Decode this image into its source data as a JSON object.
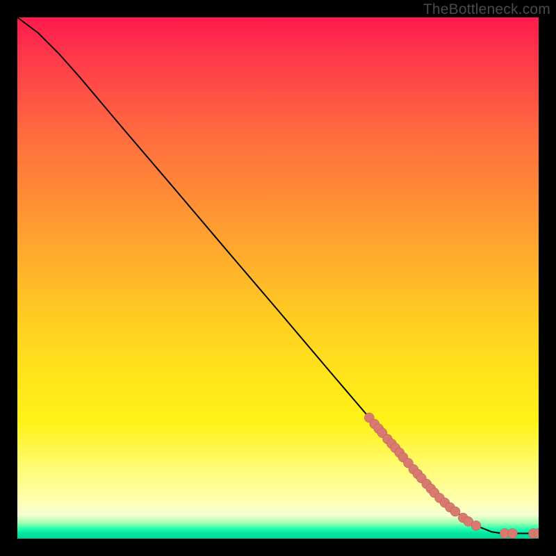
{
  "watermark": "TheBottleneck.com",
  "chart_data": {
    "type": "line",
    "title": "",
    "xlabel": "",
    "ylabel": "",
    "xlim": [
      0,
      100
    ],
    "ylim": [
      0,
      100
    ],
    "curve": [
      {
        "x": 0,
        "y": 100
      },
      {
        "x": 4,
        "y": 97
      },
      {
        "x": 8,
        "y": 93
      },
      {
        "x": 12,
        "y": 88.5
      },
      {
        "x": 20,
        "y": 79
      },
      {
        "x": 30,
        "y": 67.3
      },
      {
        "x": 40,
        "y": 55.5
      },
      {
        "x": 50,
        "y": 43.8
      },
      {
        "x": 60,
        "y": 32
      },
      {
        "x": 70,
        "y": 20.3
      },
      {
        "x": 78,
        "y": 11
      },
      {
        "x": 84,
        "y": 5.2
      },
      {
        "x": 88,
        "y": 2.5
      },
      {
        "x": 91,
        "y": 1.3
      },
      {
        "x": 93,
        "y": 1.0
      },
      {
        "x": 96,
        "y": 1.0
      },
      {
        "x": 98,
        "y": 1.0
      },
      {
        "x": 100,
        "y": 1.0
      }
    ],
    "points": [
      {
        "x": 67.5,
        "y": 23.2
      },
      {
        "x": 68.5,
        "y": 22.0
      },
      {
        "x": 69.3,
        "y": 21.1
      },
      {
        "x": 70.0,
        "y": 20.3
      },
      {
        "x": 71.0,
        "y": 19.1
      },
      {
        "x": 71.8,
        "y": 18.2
      },
      {
        "x": 72.5,
        "y": 17.4
      },
      {
        "x": 73.3,
        "y": 16.5
      },
      {
        "x": 74.0,
        "y": 15.6
      },
      {
        "x": 75.0,
        "y": 14.5
      },
      {
        "x": 76.0,
        "y": 13.3
      },
      {
        "x": 76.8,
        "y": 12.4
      },
      {
        "x": 77.5,
        "y": 11.6
      },
      {
        "x": 78.5,
        "y": 10.5
      },
      {
        "x": 79.3,
        "y": 9.6
      },
      {
        "x": 80.0,
        "y": 8.8
      },
      {
        "x": 81.0,
        "y": 7.8
      },
      {
        "x": 82.0,
        "y": 6.9
      },
      {
        "x": 83.0,
        "y": 6.0
      },
      {
        "x": 84.0,
        "y": 5.2
      },
      {
        "x": 85.5,
        "y": 4.0
      },
      {
        "x": 86.5,
        "y": 3.3
      },
      {
        "x": 88.0,
        "y": 2.5
      },
      {
        "x": 93.5,
        "y": 1.0
      },
      {
        "x": 95.0,
        "y": 1.0
      },
      {
        "x": 99.0,
        "y": 1.0
      },
      {
        "x": 100.0,
        "y": 1.0
      }
    ],
    "colors": {
      "curve": "#000000",
      "point_fill": "#d87a6f",
      "point_stroke": "#b85a52",
      "gradient_top": "#ff1a4d",
      "gradient_bottom": "#00d49a"
    }
  }
}
